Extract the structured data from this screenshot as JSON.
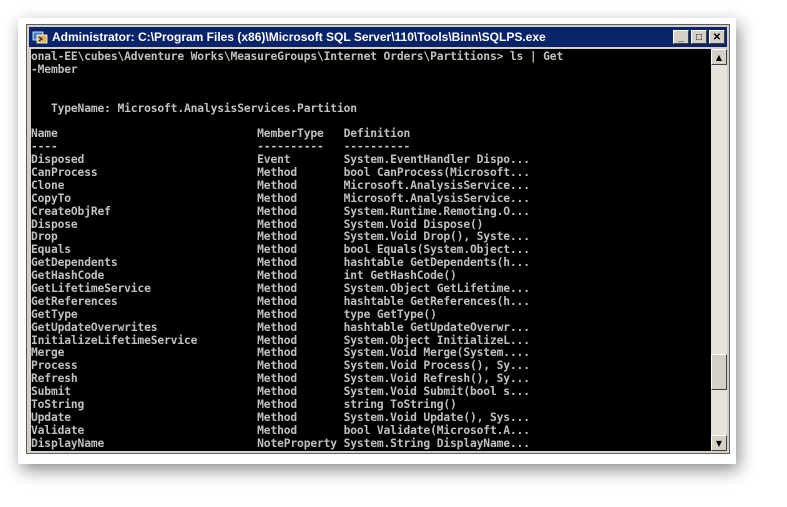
{
  "window": {
    "title": "Administrator: C:\\Program Files (x86)\\Microsoft SQL Server\\110\\Tools\\Binn\\SQLPS.exe",
    "icon": "powershell-icon",
    "buttons": {
      "minimize": "_",
      "maximize": "□",
      "close": "✕"
    }
  },
  "console": {
    "lines": [
      "onal-EE\\cubes\\Adventure Works\\MeasureGroups\\Internet Orders\\Partitions> ls | Get",
      "-Member",
      "",
      "",
      "   TypeName: Microsoft.AnalysisServices.Partition",
      "",
      "Name                              MemberType   Definition",
      "----                              ----------   ----------",
      "Disposed                          Event        System.EventHandler Dispo...",
      "CanProcess                        Method       bool CanProcess(Microsoft...",
      "Clone                             Method       Microsoft.AnalysisService...",
      "CopyTo                            Method       Microsoft.AnalysisService...",
      "CreateObjRef                      Method       System.Runtime.Remoting.O...",
      "Dispose                           Method       System.Void Dispose()",
      "Drop                              Method       System.Void Drop(), Syste...",
      "Equals                            Method       bool Equals(System.Object...",
      "GetDependents                     Method       hashtable GetDependents(h...",
      "GetHashCode                       Method       int GetHashCode()",
      "GetLifetimeService                Method       System.Object GetLifetime...",
      "GetReferences                     Method       hashtable GetReferences(h...",
      "GetType                           Method       type GetType()",
      "GetUpdateOverwrites               Method       hashtable GetUpdateOverwr...",
      "InitializeLifetimeService         Method       System.Object InitializeL...",
      "Merge                             Method       System.Void Merge(System....",
      "Process                           Method       System.Void Process(), Sy...",
      "Refresh                           Method       System.Void Refresh(), Sy...",
      "Submit                            Method       System.Void Submit(bool s...",
      "ToString                          Method       string ToString()",
      "Update                            Method       System.Void Update(), Sys...",
      "Validate                          Method       bool Validate(Microsoft.A...",
      "DisplayName                       NoteProperty System.String DisplayName..."
    ]
  },
  "scrollbar": {
    "up": "▲",
    "down": "▼"
  },
  "colors": {
    "titlebar": "#0a246a",
    "console_bg": "#000000",
    "console_fg": "#c0c0c0"
  }
}
